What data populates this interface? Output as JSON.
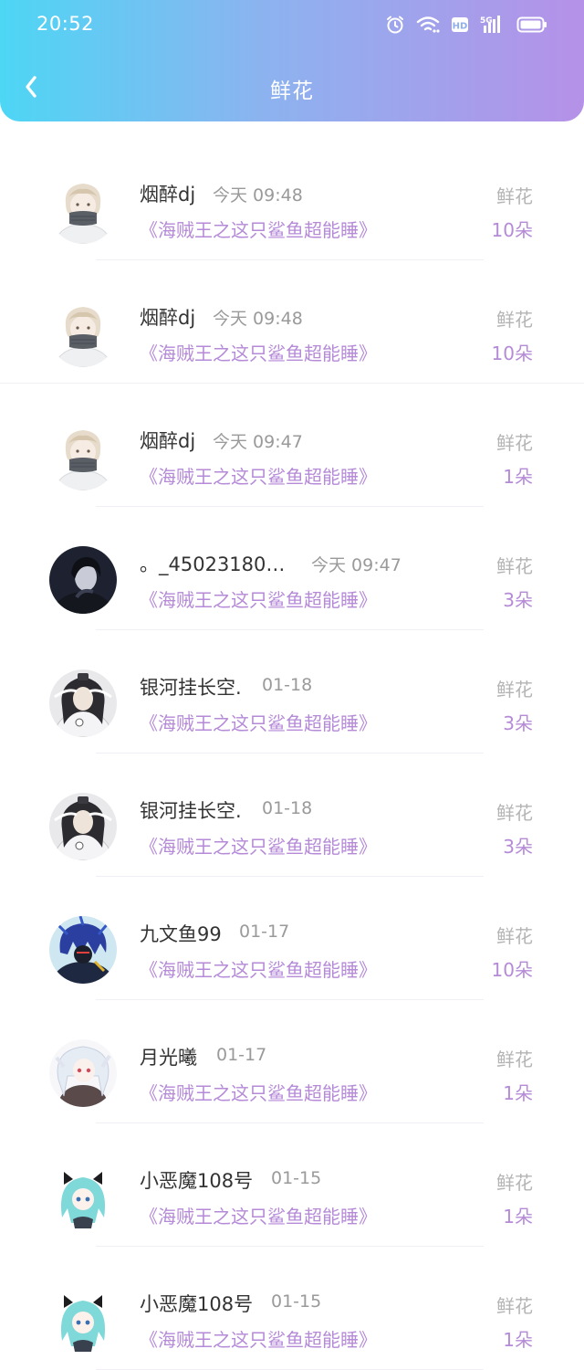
{
  "status_bar": {
    "time": "20:52",
    "icons": [
      "alarm-icon",
      "wifi-icon",
      "hd-icon",
      "5g-signal-icon",
      "battery-icon"
    ]
  },
  "nav": {
    "title": "鲜花",
    "back_icon": "chevron-left-icon"
  },
  "colors": {
    "header_gradient_start": "#4dd6f5",
    "header_gradient_end": "#b591e8",
    "accent_purple": "#b58ad7",
    "name_text": "#333333",
    "muted_text": "#9a9a9a"
  },
  "records": [
    {
      "name": "烟醉dj",
      "time": "今天 09:48",
      "book": "《海贼王之这只鲨鱼超能睡》",
      "gift_label": "鲜花",
      "gift_count": "10朵",
      "avatar_style": "masked-boy"
    },
    {
      "name": "烟醉dj",
      "time": "今天 09:48",
      "book": "《海贼王之这只鲨鱼超能睡》",
      "gift_label": "鲜花",
      "gift_count": "10朵",
      "avatar_style": "masked-boy"
    },
    {
      "name": "烟醉dj",
      "time": "今天 09:47",
      "book": "《海贼王之这只鲨鱼超能睡》",
      "gift_label": "鲜花",
      "gift_count": "1朵",
      "avatar_style": "masked-boy"
    },
    {
      "name": "。_450231805...",
      "time": "今天 09:47",
      "book": "《海贼王之这只鲨鱼超能睡》",
      "gift_label": "鲜花",
      "gift_count": "3朵",
      "avatar_style": "dark-boy"
    },
    {
      "name": "银河挂长空.",
      "time": "01-18",
      "book": "《海贼王之这只鲨鱼超能睡》",
      "gift_label": "鲜花",
      "gift_count": "3朵",
      "avatar_style": "ancient-man"
    },
    {
      "name": "银河挂长空.",
      "time": "01-18",
      "book": "《海贼王之这只鲨鱼超能睡》",
      "gift_label": "鲜花",
      "gift_count": "3朵",
      "avatar_style": "ancient-man"
    },
    {
      "name": "九文鱼99",
      "time": "01-17",
      "book": "《海贼王之这只鲨鱼超能睡》",
      "gift_label": "鲜花",
      "gift_count": "10朵",
      "avatar_style": "blue-hair"
    },
    {
      "name": "月光曦",
      "time": "01-17",
      "book": "《海贼王之这只鲨鱼超能睡》",
      "gift_label": "鲜花",
      "gift_count": "1朵",
      "avatar_style": "white-hair-girl"
    },
    {
      "name": "小恶魔108号",
      "time": "01-15",
      "book": "《海贼王之这只鲨鱼超能睡》",
      "gift_label": "鲜花",
      "gift_count": "1朵",
      "avatar_style": "teal-hair-girl"
    },
    {
      "name": "小恶魔108号",
      "time": "01-15",
      "book": "《海贼王之这只鲨鱼超能睡》",
      "gift_label": "鲜花",
      "gift_count": "1朵",
      "avatar_style": "teal-hair-girl"
    }
  ]
}
